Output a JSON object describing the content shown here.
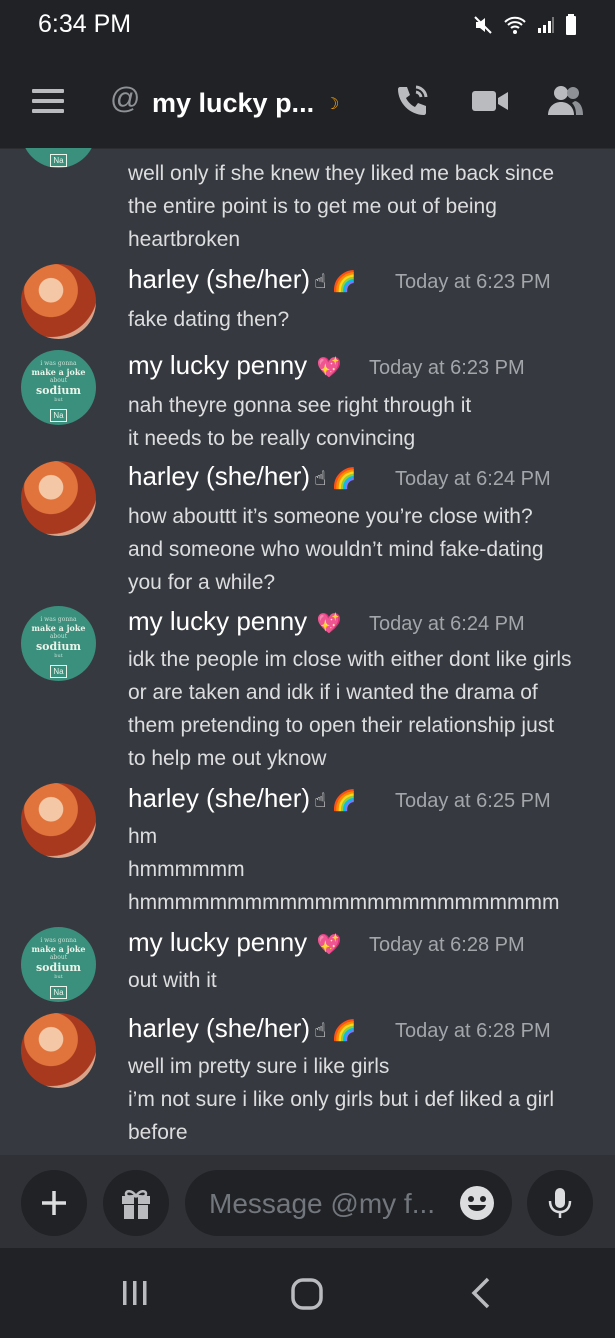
{
  "status": {
    "time": "6:34 PM"
  },
  "header": {
    "channel_title": "my lucky p..."
  },
  "messages": [
    {
      "type": "continuation",
      "lines": [
        "well only if she knew they liked me back since",
        "the entire point is to get me out of being",
        "heartbroken"
      ]
    },
    {
      "author": "harley (she/her)",
      "timestamp": "Today at 6:23 PM",
      "lines": [
        "fake dating then?"
      ]
    },
    {
      "author": "my lucky penny",
      "timestamp": "Today at 6:23 PM",
      "lines": [
        "nah theyre gonna see right through it",
        "it needs to be really convincing"
      ]
    },
    {
      "author": "harley (she/her)",
      "timestamp": "Today at 6:24 PM",
      "lines": [
        "how abouttt it’s someone you’re close with?",
        "and someone who wouldn’t mind fake-dating",
        "you for a while?"
      ]
    },
    {
      "author": "my lucky penny",
      "timestamp": "Today at 6:24 PM",
      "lines": [
        "idk the people im close with either dont like girls",
        "or are taken and idk if i wanted the drama of",
        "them pretending to open their relationship just",
        "to help me out yknow"
      ]
    },
    {
      "author": "harley (she/her)",
      "timestamp": "Today at 6:25 PM",
      "lines": [
        "hm",
        "hmmmmmm",
        "hmmmmmmmmmmmmmmmmmmmmmmmm"
      ]
    },
    {
      "author": "my lucky penny",
      "timestamp": "Today at 6:28 PM",
      "lines": [
        "out with it"
      ]
    },
    {
      "author": "harley (she/her)",
      "timestamp": "Today at 6:28 PM",
      "lines": [
        "well im pretty sure i like girls",
        "i’m not sure i like only girls but i def liked a girl",
        "before"
      ]
    }
  ],
  "avatar_text": {
    "line1": "i was gonna",
    "line2": "make a joke",
    "line3": "about",
    "line4": "sodium",
    "line5": "but",
    "element": "Na"
  },
  "composer": {
    "placeholder": "Message @my f..."
  },
  "colors": {
    "background": "#36393f",
    "bars": "#202225",
    "text": "#dcddde",
    "timestamp": "#a3a6aa",
    "avatar_penny": "#3b8f7d"
  }
}
